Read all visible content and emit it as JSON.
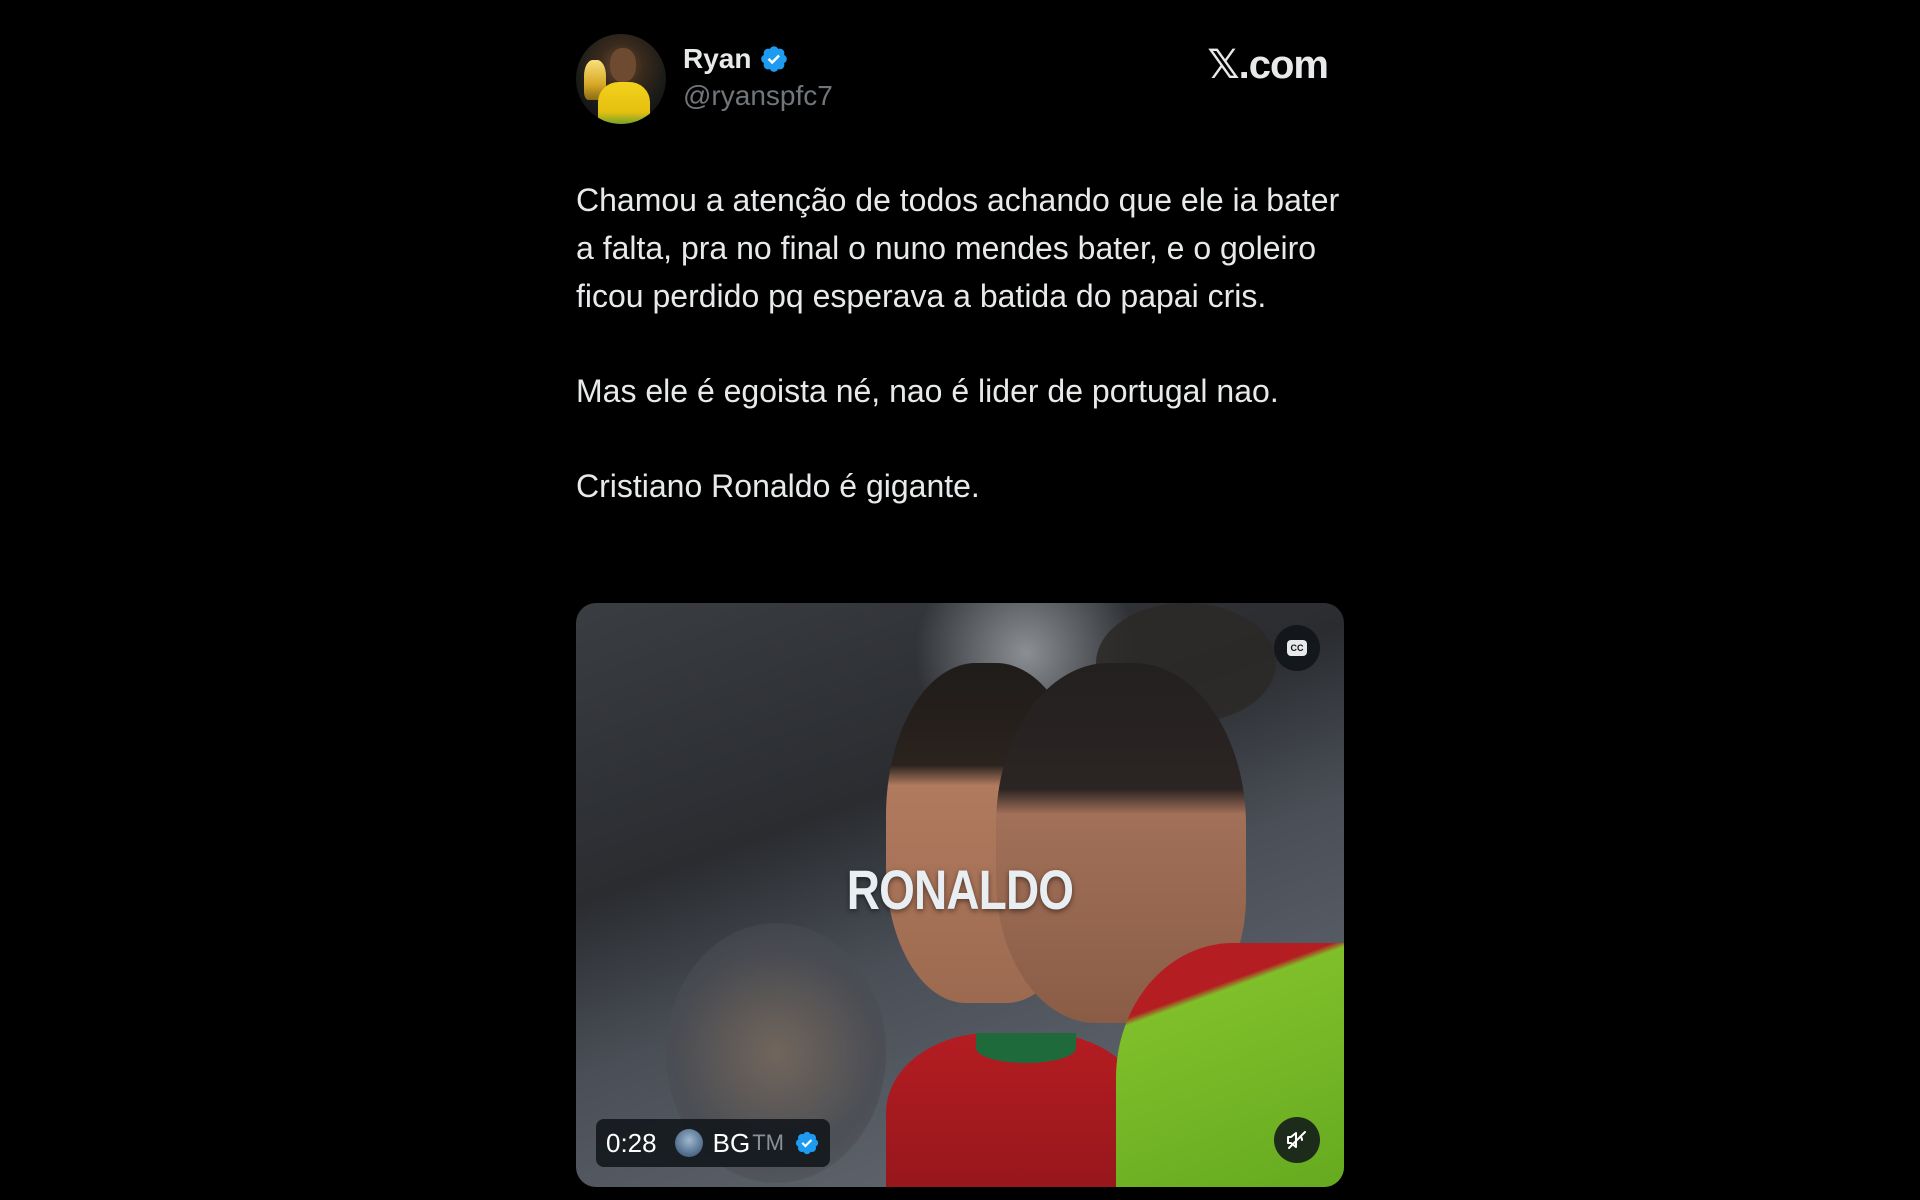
{
  "brand": {
    "label": "𝕏.com"
  },
  "author": {
    "display_name": "Ryan",
    "handle": "@ryanspfc7",
    "verified_color": "#1d9bf0"
  },
  "tweet": {
    "paragraphs": [
      "Chamou a atenção de todos achando que ele ia bater a falta, pra no final o nuno mendes bater, e o goleiro ficou perdido pq esperava a batida do papai cris.",
      "Mas ele é egoista né, nao é lider de portugal nao.",
      "Cristiano Ronaldo é gigante."
    ]
  },
  "media": {
    "overlay_text": "RONALDO",
    "cc_label": "CC",
    "duration": "0:28",
    "source_name": "BG",
    "source_suffix": "TM",
    "icons": [
      "cc-icon",
      "mute-icon",
      "verified-icon"
    ]
  },
  "colors": {
    "background": "#000000",
    "text": "#e7e9ea",
    "secondary_text": "#71767b",
    "accent": "#1d9bf0"
  }
}
